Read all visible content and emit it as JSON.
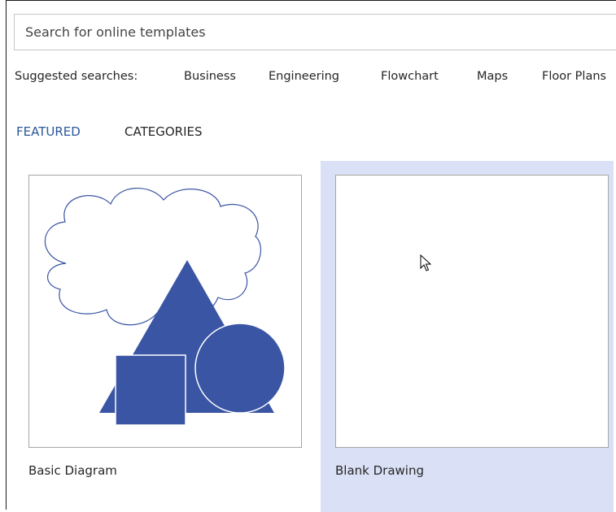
{
  "search": {
    "placeholder": "Search for online templates"
  },
  "suggested": {
    "label": "Suggested searches:",
    "items": [
      "Business",
      "Engineering",
      "Flowchart",
      "Maps",
      "Floor Plans"
    ]
  },
  "tabs": [
    {
      "label": "FEATURED",
      "active": true
    },
    {
      "label": "CATEGORIES",
      "active": false
    }
  ],
  "templates": [
    {
      "label": "Basic Diagram",
      "selected": false
    },
    {
      "label": "Blank Drawing",
      "selected": true
    }
  ],
  "colors": {
    "accent": "#2b579a",
    "shape_fill": "#3a55a4",
    "selected_bg": "#dae1f6"
  },
  "cursor": {
    "icon": "arrow-cursor-icon"
  }
}
